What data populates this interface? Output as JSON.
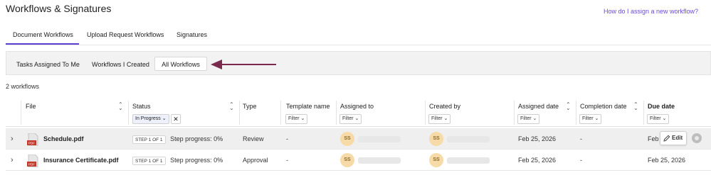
{
  "header": {
    "title": "Workflows & Signatures",
    "help_link": "How do I assign a new workflow?"
  },
  "main_tabs": [
    {
      "label": "Document Workflows",
      "active": true
    },
    {
      "label": "Upload Request Workflows",
      "active": false
    },
    {
      "label": "Signatures",
      "active": false
    }
  ],
  "sub_tabs": [
    {
      "label": "Tasks Assigned To Me",
      "active": false
    },
    {
      "label": "Workflows I Created",
      "active": false
    },
    {
      "label": "All Workflows",
      "active": true
    }
  ],
  "colors": {
    "accent": "#5b3fd0",
    "arrow": "#7a2a4e",
    "avatar": "#f6dba8",
    "link": "#6a4bd6"
  },
  "count_text": "2 workflows",
  "table": {
    "columns": {
      "file": "File",
      "status": "Status",
      "type": "Type",
      "template_name": "Template name",
      "assigned_to": "Assigned to",
      "created_by": "Created by",
      "assigned_date": "Assigned date",
      "completion_date": "Completion date",
      "due_date": "Due date"
    },
    "filter_label": "Filter",
    "status_filter_value": "In Progress",
    "rows": [
      {
        "file": "Schedule.pdf",
        "step": "STEP 1 OF 1",
        "progress": "Step progress: 0%",
        "type": "Review",
        "template": "-",
        "assigned_to_initials": "SS",
        "created_by_initials": "SS",
        "assigned_date": "Feb 25, 2026",
        "completion_date": "-",
        "due_date": "Feb",
        "edit_label": "Edit"
      },
      {
        "file": "Insurance Certificate.pdf",
        "step": "STEP 1 OF 1",
        "progress": "Step progress: 0%",
        "type": "Approval",
        "template": "-",
        "assigned_to_initials": "SS",
        "created_by_initials": "SS",
        "assigned_date": "Feb 25, 2026",
        "completion_date": "-",
        "due_date": "Feb 25, 2026"
      }
    ]
  },
  "icons": [
    "pdf-icon",
    "chevron-right-icon",
    "chevron-down-icon",
    "sort-icon",
    "close-icon",
    "pencil-icon",
    "more-icon",
    "arrow-left-icon"
  ]
}
